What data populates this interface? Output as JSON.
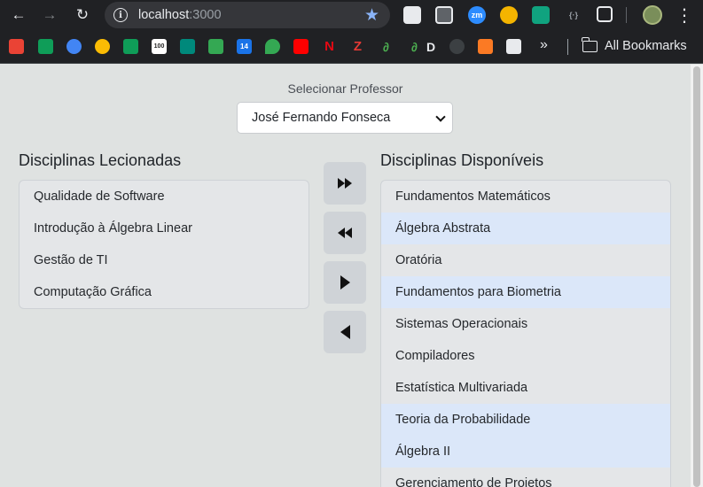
{
  "browser": {
    "url_host": "localhost",
    "url_port": ":3000",
    "bookmarks_label": "All Bookmarks",
    "bookmark_d_label": "D",
    "zm_label": "zm",
    "more_glyph": "»"
  },
  "page": {
    "select_label": "Selecionar Professor",
    "selected_professor": "José Fernando Fonseca",
    "taught_heading": "Disciplinas Lecionadas",
    "available_heading": "Disciplinas Disponíveis",
    "taught": [
      {
        "label": "Qualidade de Software"
      },
      {
        "label": "Introdução à Álgebra Linear"
      },
      {
        "label": "Gestão de TI"
      },
      {
        "label": "Computação Gráfica"
      }
    ],
    "available": [
      {
        "label": "Fundamentos Matemáticos",
        "highlighted": false
      },
      {
        "label": "Álgebra Abstrata",
        "highlighted": true
      },
      {
        "label": "Oratória",
        "highlighted": false
      },
      {
        "label": "Fundamentos para Biometria",
        "highlighted": true
      },
      {
        "label": "Sistemas Operacionais",
        "highlighted": false
      },
      {
        "label": "Compiladores",
        "highlighted": false
      },
      {
        "label": "Estatística Multivariada",
        "highlighted": false
      },
      {
        "label": "Teoria da Probabilidade",
        "highlighted": true
      },
      {
        "label": "Álgebra II",
        "highlighted": true
      },
      {
        "label": "Gerenciamento de Projetos",
        "highlighted": false
      }
    ],
    "colors": {
      "background": "#dfe2e1",
      "highlight": "#dbe7f9",
      "button": "#cfd3d7"
    }
  }
}
